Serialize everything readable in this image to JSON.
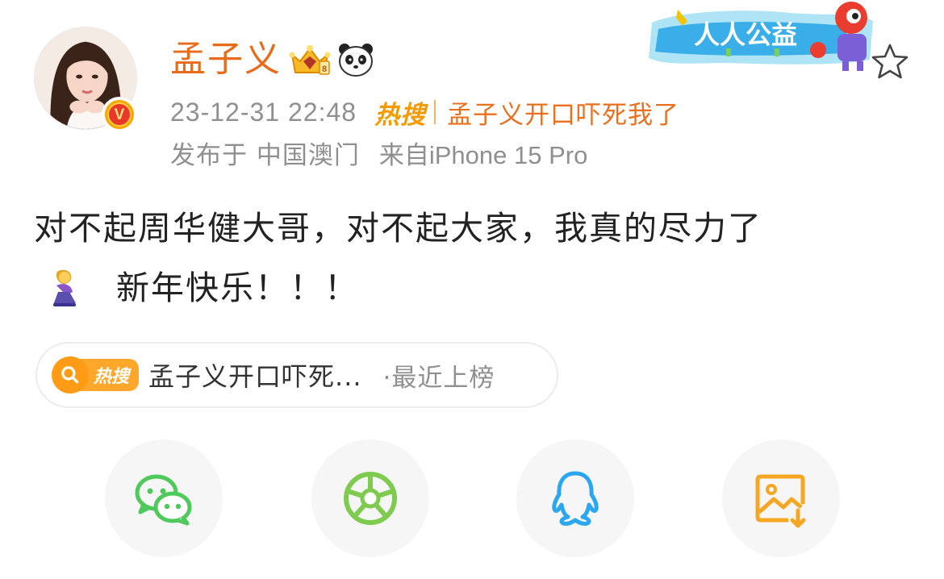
{
  "post": {
    "author": {
      "name": "孟子义",
      "verified_badge": "V",
      "badges": [
        "crown-icon",
        "panda-icon"
      ]
    },
    "timestamp": "23-12-31 22:48",
    "hot_tag": "热搜",
    "hot_topic": "孟子义开口吓死我了",
    "location": "发布于 中国澳门",
    "source": "来自iPhone 15 Pro",
    "text_line1": "对不起周华健大哥，对不起大家，我真的尽力了",
    "text_line2": "新年快乐！！！",
    "emoji": "kneeling-woman-emoji"
  },
  "banner": {
    "text": "人人公益",
    "star": "favorite-star-icon"
  },
  "hot_search_card": {
    "badge": "热搜",
    "title": "孟子义开口吓死...",
    "status": "·最近上榜"
  },
  "share": [
    {
      "name": "wechat",
      "icon": "wechat-icon",
      "color": "#4fc95c"
    },
    {
      "name": "moments",
      "icon": "moments-icon",
      "color": "#7ecb4f"
    },
    {
      "name": "qq",
      "icon": "qq-icon",
      "color": "#2aa7f0"
    },
    {
      "name": "save-image",
      "icon": "save-image-icon",
      "color": "#f5a623"
    }
  ],
  "colors": {
    "accent": "#e86b1c",
    "meta_gray": "#8f8f8f",
    "hot_orange": "#f59a00"
  }
}
